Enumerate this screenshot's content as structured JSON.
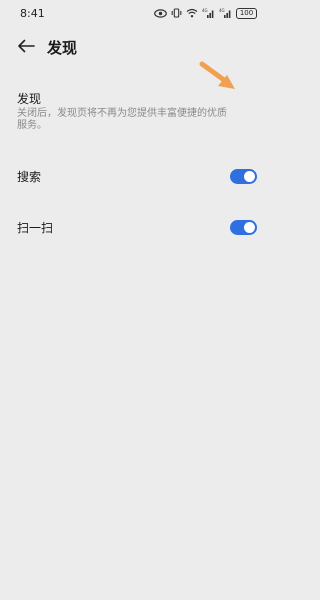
{
  "status_bar": {
    "time": "8:41",
    "battery": "100",
    "icons": [
      "eye-icon",
      "vibrate-icon",
      "wifi-icon",
      "signal-icon",
      "signal-icon",
      "battery-icon"
    ]
  },
  "header": {
    "title": "发现",
    "back_icon": "arrow-left-icon"
  },
  "discover": {
    "title": "发现",
    "description": "关闭后，发现页将不再为您提供丰富便捷的优质服务。"
  },
  "settings": [
    {
      "label": "搜索",
      "enabled": true
    },
    {
      "label": "扫一扫",
      "enabled": true
    }
  ],
  "colors": {
    "background": "#ececec",
    "toggle_on": "#2f6fe0",
    "annotation_arrow": "#f0a050"
  }
}
